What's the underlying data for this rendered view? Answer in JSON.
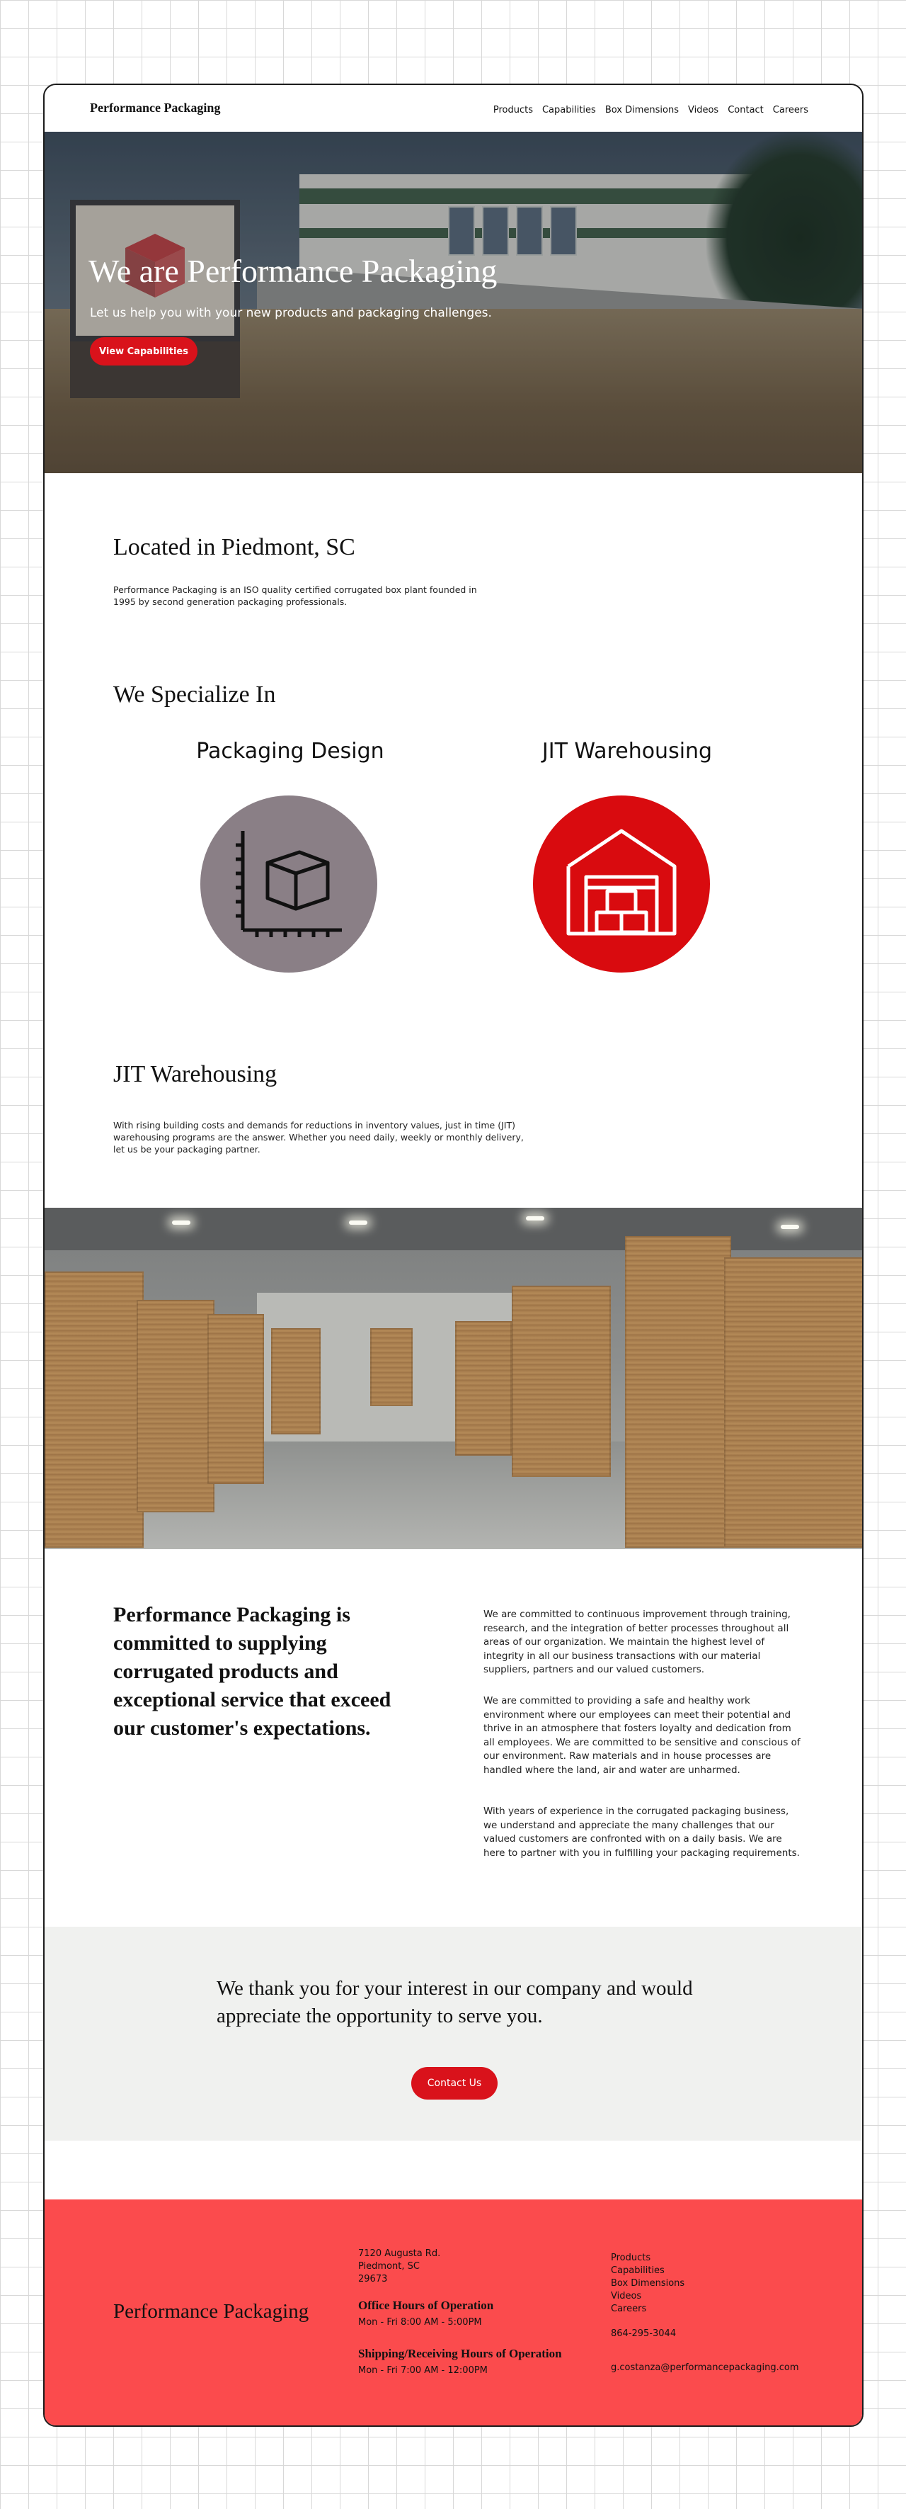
{
  "header": {
    "logo": "Performance Packaging",
    "nav": [
      "Products",
      "Capabilities",
      "Box Dimensions",
      "Videos",
      "Contact",
      "Careers"
    ]
  },
  "hero": {
    "title": "We are Performance Packaging",
    "subtitle": "Let us help you with your new products and packaging challenges.",
    "cta_label": "View Capabilities"
  },
  "located": {
    "title": "Located in Piedmont, SC",
    "text": "Performance Packaging is an ISO quality certified corrugated box plant founded in 1995 by second generation packaging professionals."
  },
  "specialize": {
    "title": "We Specialize In",
    "items": [
      {
        "label": "Packaging Design",
        "icon": "box-design-icon",
        "color": "#8a7f86"
      },
      {
        "label": "JIT Warehousing",
        "icon": "warehouse-icon",
        "color": "#d90b0f"
      }
    ]
  },
  "jit": {
    "title": "JIT Warehousing",
    "text": "With rising building costs and demands for reductions in inventory values, just in time (JIT) warehousing programs are the answer. Whether you need daily, weekly or monthly delivery, let us be your packaging partner."
  },
  "commitment": {
    "title": "Performance Packaging is committed to supplying corrugated products and exceptional service that exceed our customer's expectations.",
    "paragraphs": [
      "We are committed to continuous improvement through training, research, and the integration of better processes throughout all areas of our organization. We maintain the highest level of integrity in all our business transactions with our material suppliers, partners and our valued customers.",
      "We are committed to providing a safe and healthy work environment where our employees can meet their potential and thrive in an atmosphere that fosters loyalty and dedication from all employees. We are committed to be sensitive and conscious of our environment. Raw materials and in house processes are handled where the land, air and water are unharmed.",
      "With years of experience in the corrugated packaging business, we understand and appreciate the many challenges that our valued customers are confronted with on a daily basis. We are here to partner with you in fulfilling your packaging requirements."
    ]
  },
  "thanks": {
    "text": "We thank you for your interest in our company and would appreciate the opportunity to serve you.",
    "button": "Contact Us"
  },
  "footer": {
    "logo": "Performance Packaging",
    "address": [
      "7120 Augusta Rd.",
      "Piedmont, SC",
      "29673"
    ],
    "office_heading": "Office Hours of Operation",
    "office_hours": "Mon - Fri 8:00 AM - 5:00PM",
    "shipping_heading": "Shipping/Receiving Hours of Operation",
    "shipping_hours": "Mon - Fri 7:00 AM - 12:00PM",
    "links": [
      "Products",
      "Capabilities",
      "Box Dimensions",
      "Videos",
      "Careers"
    ],
    "phone": "864-295-3044",
    "email": "g.costanza@performancepackaging.com"
  },
  "colors": {
    "accent": "#d9121b",
    "footer_bg": "#fb4b4d",
    "band_bg": "#f0f1ef"
  }
}
